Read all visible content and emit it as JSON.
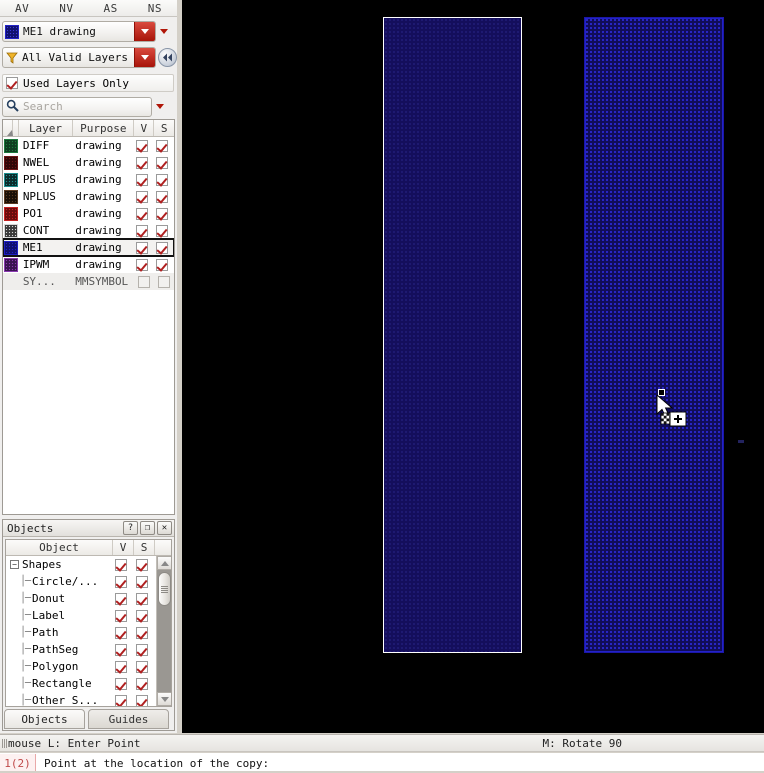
{
  "app": {
    "canvas_bg": "#000000"
  },
  "layer_panel": {
    "column_letters": [
      "AV",
      "NV",
      "AS",
      "NS"
    ],
    "current_layer": {
      "label": "ME1 drawing",
      "swatch_color": "#1b1b9e",
      "dropdown_icon": "chevron-down-icon",
      "extra_arrow_icon": "chevron-down-icon"
    },
    "filter": {
      "label": "All Valid Layers",
      "icon": "funnel-icon",
      "dropdown_icon": "chevron-down-icon",
      "rewind_icon": "rewind-icon",
      "rewind_glyph": "⏪"
    },
    "used_layers_only": {
      "label": "Used Layers Only",
      "checked": true
    },
    "search": {
      "placeholder": "Search",
      "value": "",
      "icon": "search-icon",
      "dropdown_icon": "chevron-down-icon",
      "extra_arrow_icon": "chevron-down-icon"
    },
    "table": {
      "headers": {
        "sort": "",
        "layer": "Layer",
        "purpose": "Purpose",
        "v": "V",
        "s": "S"
      },
      "rows": [
        {
          "name": "DIFF",
          "purpose": "drawing",
          "color": "#1c7a3c",
          "fill": "#0f3d20",
          "v": true,
          "s": true,
          "selected": false,
          "dim": false
        },
        {
          "name": "NWEL",
          "purpose": "drawing",
          "color": "#6d1414",
          "fill": "#300707",
          "v": true,
          "s": true,
          "selected": false,
          "dim": false
        },
        {
          "name": "PPLUS",
          "purpose": "drawing",
          "color": "#1d8f8f",
          "fill": "#0b2b2b",
          "v": true,
          "s": true,
          "selected": false,
          "dim": false
        },
        {
          "name": "NPLUS",
          "purpose": "drawing",
          "color": "#5a3a20",
          "fill": "#1a0f06",
          "v": true,
          "s": true,
          "selected": false,
          "dim": false
        },
        {
          "name": "PO1",
          "purpose": "drawing",
          "color": "#c42020",
          "fill": "#6b0c0c",
          "v": true,
          "s": true,
          "selected": false,
          "dim": false
        },
        {
          "name": "CONT",
          "purpose": "drawing",
          "color": "#d8d8d8",
          "fill": "#3a3a3a",
          "v": true,
          "s": true,
          "selected": false,
          "dim": false
        },
        {
          "name": "ME1",
          "purpose": "drawing",
          "color": "#2020c8",
          "fill": "#10106e",
          "v": true,
          "s": true,
          "selected": true,
          "dim": false
        },
        {
          "name": "IPWM",
          "purpose": "drawing",
          "color": "#8a3ab0",
          "fill": "#3a1450",
          "v": true,
          "s": true,
          "selected": false,
          "dim": false
        },
        {
          "name": "SY...",
          "purpose": "MMSYMBOL",
          "color": "",
          "fill": "",
          "v": false,
          "s": false,
          "selected": false,
          "dim": true
        }
      ]
    }
  },
  "objects_panel": {
    "title": "Objects",
    "title_buttons": [
      {
        "name": "help-button",
        "glyph": "?"
      },
      {
        "name": "undock-button",
        "glyph": "❐"
      },
      {
        "name": "close-button",
        "glyph": "✕"
      }
    ],
    "headers": {
      "object": "Object",
      "v": "V",
      "s": "S"
    },
    "rows": [
      {
        "label": "Shapes",
        "depth": 0,
        "expander": "minus",
        "v": true,
        "s": true
      },
      {
        "label": "Circle/...",
        "depth": 1,
        "expander": "none",
        "v": true,
        "s": true
      },
      {
        "label": "Donut",
        "depth": 1,
        "expander": "none",
        "v": true,
        "s": true
      },
      {
        "label": "Label",
        "depth": 1,
        "expander": "none",
        "v": true,
        "s": true
      },
      {
        "label": "Path",
        "depth": 1,
        "expander": "none",
        "v": true,
        "s": true
      },
      {
        "label": "PathSeg",
        "depth": 1,
        "expander": "none",
        "v": true,
        "s": true
      },
      {
        "label": "Polygon",
        "depth": 1,
        "expander": "none",
        "v": true,
        "s": true
      },
      {
        "label": "Rectangle",
        "depth": 1,
        "expander": "none",
        "v": true,
        "s": true
      },
      {
        "label": "Other S...",
        "depth": 1,
        "expander": "none",
        "v": true,
        "s": true
      }
    ],
    "tabs": [
      {
        "label": "Objects",
        "active": true
      },
      {
        "label": "Guides",
        "active": false
      }
    ]
  },
  "canvas": {
    "shapes": [
      {
        "name": "rectangle-original",
        "layer": "ME1",
        "state": "normal",
        "fill": "#140e5c",
        "stroke": "#ffffff"
      },
      {
        "name": "rectangle-copy",
        "layer": "ME1",
        "state": "selected",
        "fill": "#110d58",
        "stroke": "#2222c8"
      }
    ],
    "cursor": {
      "name": "copy-cursor",
      "icon": "arrow-plus-cursor"
    },
    "selection_handle": {
      "name": "selection-handle"
    }
  },
  "status": {
    "mouse_hint_left": "mouse L: Enter Point",
    "mouse_hint_right": "M: Rotate 90",
    "command_counter": "1(2)",
    "prompt": "Point at the location of the copy:"
  }
}
